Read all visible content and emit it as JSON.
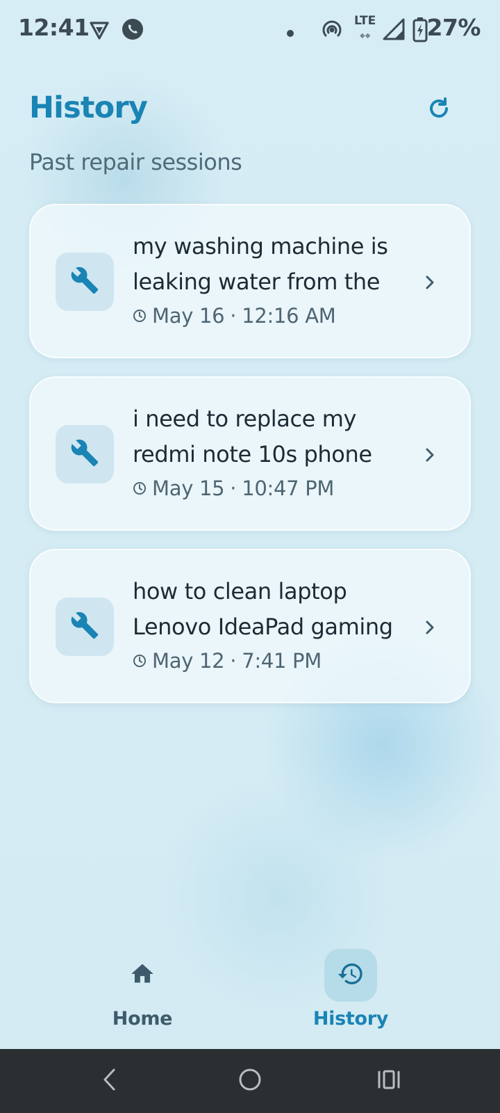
{
  "status_bar": {
    "time": "12:41",
    "network_type": "LTE",
    "battery_percent": "27%"
  },
  "header": {
    "title": "History",
    "subtitle": "Past repair sessions"
  },
  "sessions": [
    {
      "title": "my washing machine is leaking water from the",
      "date": "May 16",
      "time": "12:16 AM"
    },
    {
      "title": "i need to replace my redmi note 10s phone",
      "date": "May 15",
      "time": "10:47 PM"
    },
    {
      "title": "how to clean laptop Lenovo IdeaPad gaming",
      "date": "May 12",
      "time": "7:41 PM"
    }
  ],
  "bottom_nav": {
    "items": [
      {
        "label": "Home",
        "icon": "home-icon",
        "active": false
      },
      {
        "label": "History",
        "icon": "history-icon",
        "active": true
      }
    ]
  },
  "colors": {
    "accent": "#1a84b4",
    "background": "#d6edf5",
    "inactive_nav": "#3e5b6c",
    "system_nav": "#2b2f31"
  }
}
